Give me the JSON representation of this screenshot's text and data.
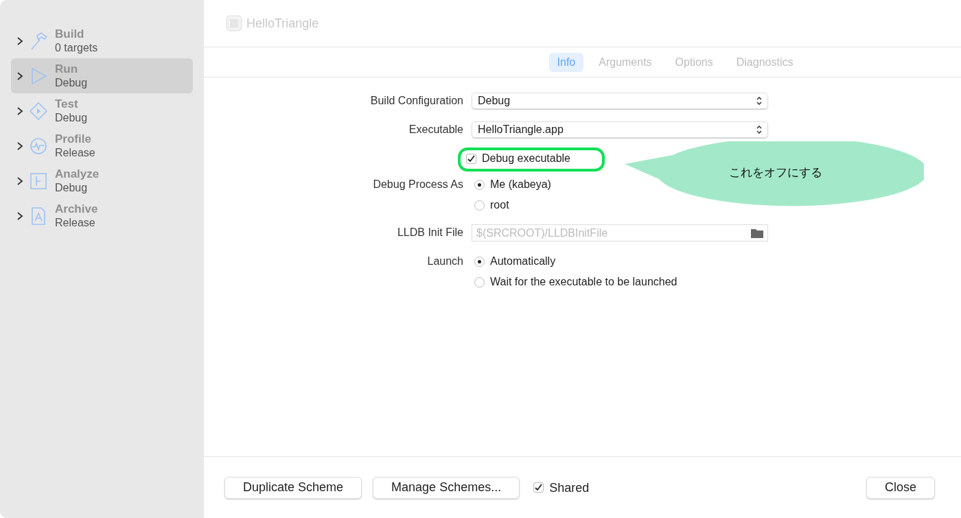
{
  "sidebar": {
    "items": [
      {
        "kind": "build",
        "title": "Build",
        "subtitle": "0 targets",
        "selected": false
      },
      {
        "kind": "run",
        "title": "Run",
        "subtitle": "Debug",
        "selected": true
      },
      {
        "kind": "test",
        "title": "Test",
        "subtitle": "Debug",
        "selected": false
      },
      {
        "kind": "profile",
        "title": "Profile",
        "subtitle": "Release",
        "selected": false
      },
      {
        "kind": "analyze",
        "title": "Analyze",
        "subtitle": "Debug",
        "selected": false
      },
      {
        "kind": "archive",
        "title": "Archive",
        "subtitle": "Release",
        "selected": false
      }
    ]
  },
  "header": {
    "title": "HelloTriangle"
  },
  "tabs": [
    {
      "label": "Info",
      "selected": true
    },
    {
      "label": "Arguments",
      "selected": false
    },
    {
      "label": "Options",
      "selected": false
    },
    {
      "label": "Diagnostics",
      "selected": false
    }
  ],
  "form": [
    {
      "kind": "popup",
      "label": "Build Configuration",
      "value": "Debug"
    },
    {
      "kind": "popup",
      "label": "Executable",
      "value": "HelloTriangle.app"
    },
    {
      "kind": "checkbox",
      "option": "Debug executable",
      "checked": true,
      "highlighted": true
    },
    {
      "kind": "radio",
      "label": "Debug Process As",
      "options": [
        {
          "label": "Me (kabeya)",
          "selected": true
        },
        {
          "label": "root",
          "selected": false
        }
      ]
    },
    {
      "kind": "file",
      "label": "LLDB Init File",
      "placeholder": "$(SRCROOT)/LLDBInitFile"
    },
    {
      "kind": "radio",
      "label": "Launch",
      "options": [
        {
          "label": "Automatically",
          "selected": true
        },
        {
          "label": "Wait for the executable to be launched",
          "selected": false
        }
      ]
    }
  ],
  "callout": {
    "text": "これをオフにする"
  },
  "footer": {
    "left_buttons": [
      "Duplicate Scheme",
      "Manage Schemes..."
    ],
    "shared": {
      "label": "Shared",
      "checked": true
    },
    "close": "Close"
  }
}
